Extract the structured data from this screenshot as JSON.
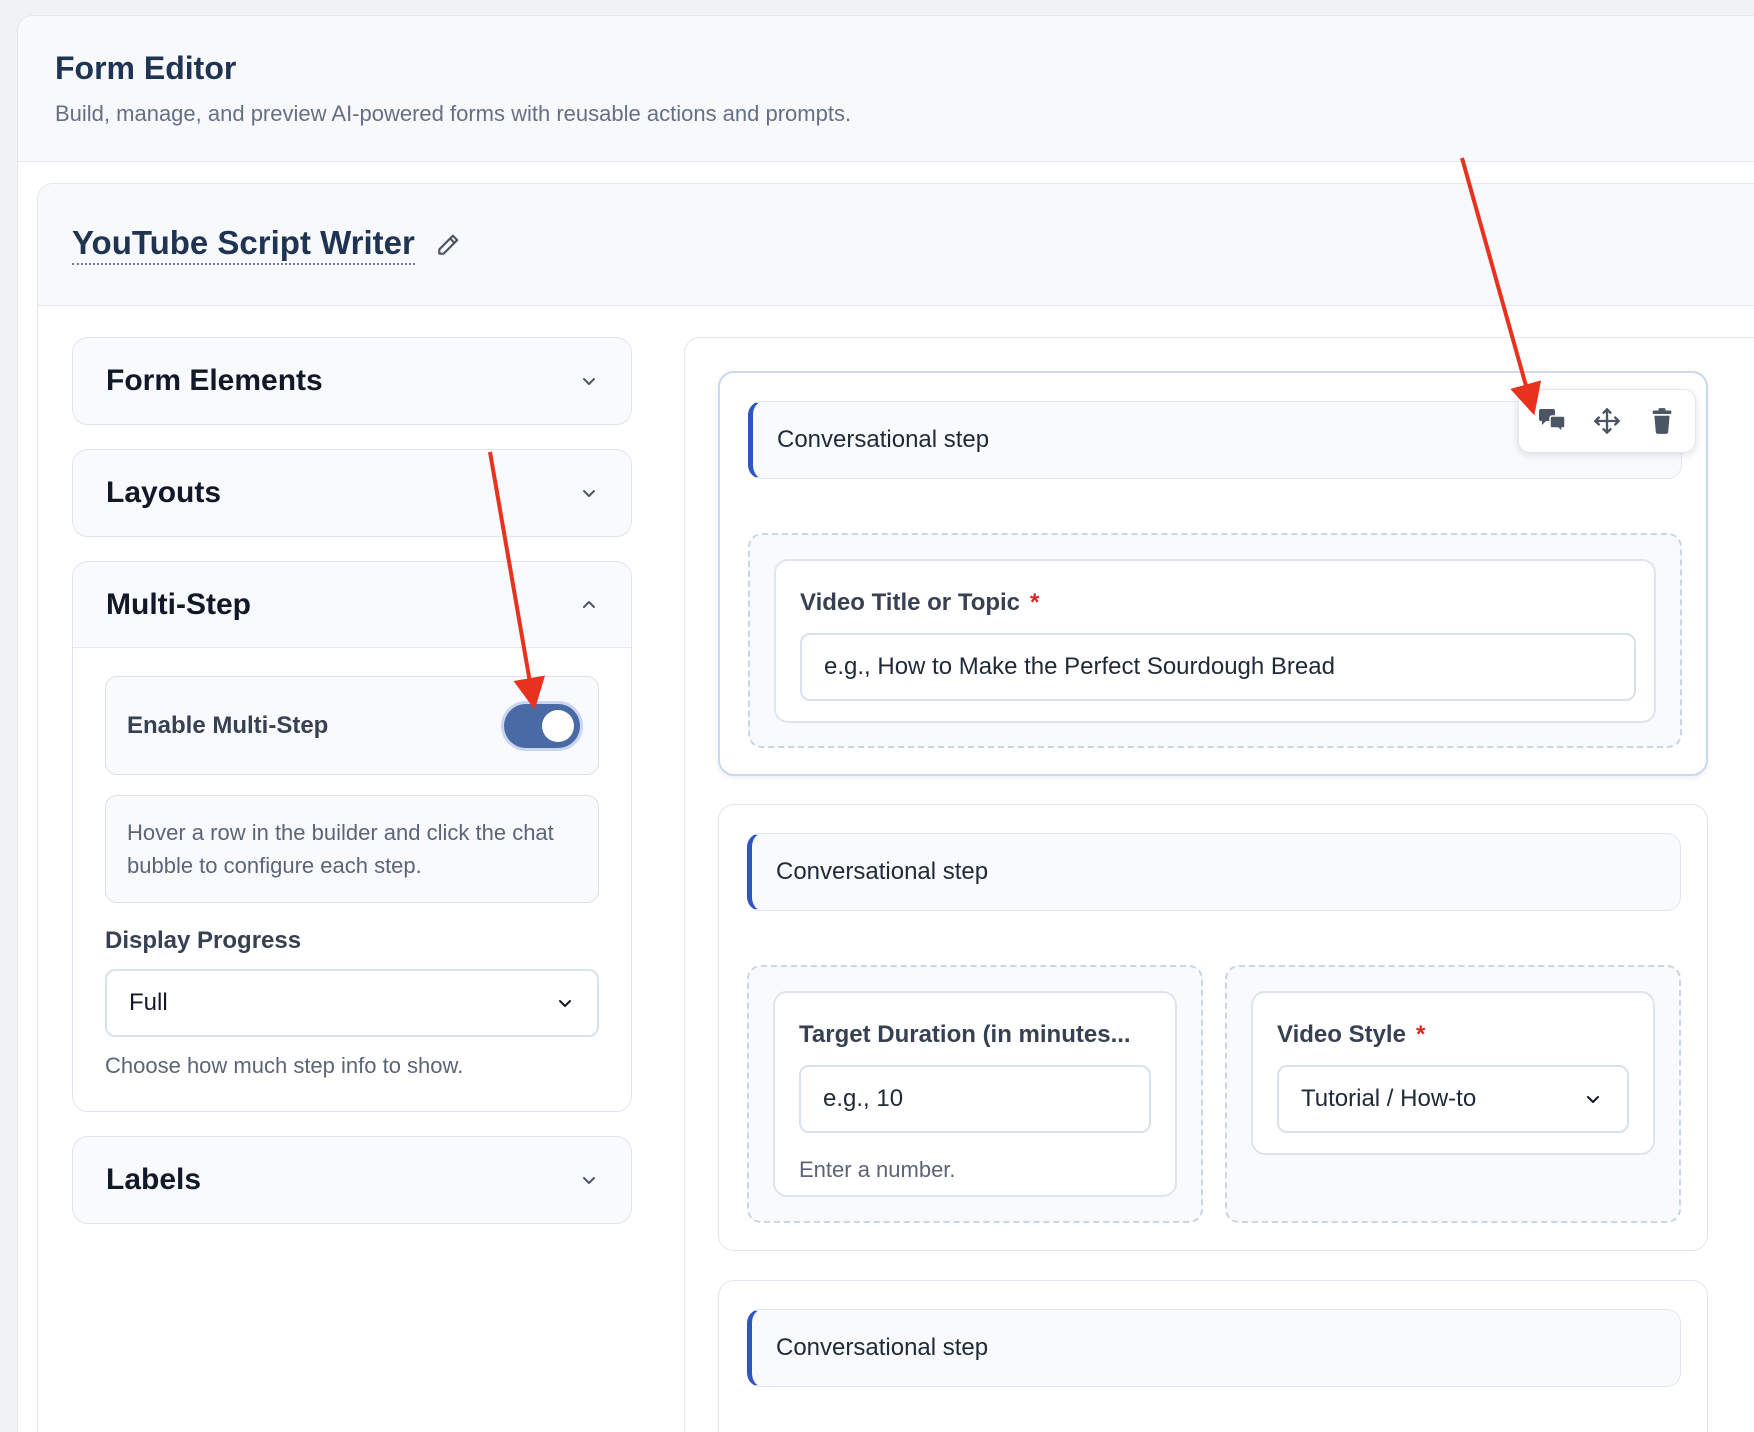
{
  "header": {
    "title": "Form Editor",
    "subtitle": "Build, manage, and preview AI-powered forms with reusable actions and prompts."
  },
  "form": {
    "name": "YouTube Script Writer",
    "edit_icon": "pencil-icon"
  },
  "sidebar": {
    "sections": {
      "form_elements": "Form Elements",
      "layouts": "Layouts",
      "multi_step": "Multi-Step",
      "labels": "Labels"
    },
    "multi_step": {
      "enable_label": "Enable Multi-Step",
      "enabled": true,
      "hint": "Hover a row in the builder and click the chat bubble to configure each step.",
      "display_progress_label": "Display Progress",
      "display_progress_value": "Full",
      "display_progress_help": "Choose how much step info to show."
    }
  },
  "builder": {
    "rows": [
      {
        "step_label": "Conversational step",
        "fields": [
          {
            "label": "Video Title or Topic",
            "required": true,
            "placeholder": "e.g., How to Make the Perfect Sourdough Bread"
          }
        ]
      },
      {
        "step_label": "Conversational step",
        "fields": [
          {
            "label": "Target Duration (in minutes...",
            "required": false,
            "placeholder": "e.g., 10",
            "help": "Enter a number."
          },
          {
            "label": "Video Style",
            "required": true,
            "value": "Tutorial / How-to"
          }
        ]
      },
      {
        "step_label": "Conversational step"
      }
    ],
    "row_tools": [
      "chat-bubble-icon",
      "move-icon",
      "trash-icon"
    ],
    "required_marker": "*"
  },
  "colors": {
    "accent": "#2f55c5",
    "toggle_on": "#4a6aa6",
    "required": "#dc2626",
    "annotation_arrow": "#e8321e"
  }
}
